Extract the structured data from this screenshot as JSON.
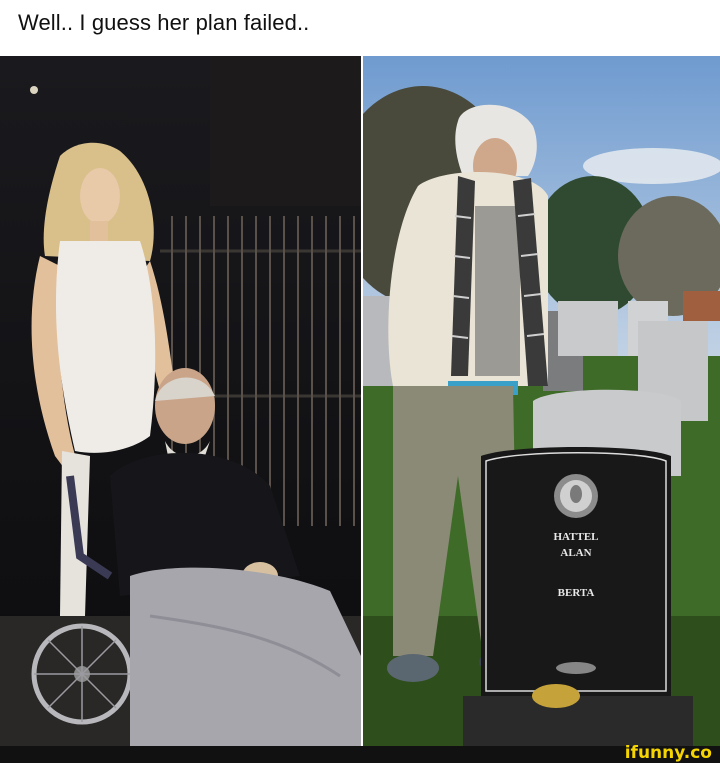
{
  "caption": "Well.. I guess her plan failed..",
  "headstone": {
    "line1": "HATTEL",
    "line2": "ALAN",
    "line3": "BERTA"
  },
  "watermark": "ifunny.co",
  "colors": {
    "background": "#ffffff",
    "footer": "#111111",
    "watermark": "#f5d400"
  }
}
